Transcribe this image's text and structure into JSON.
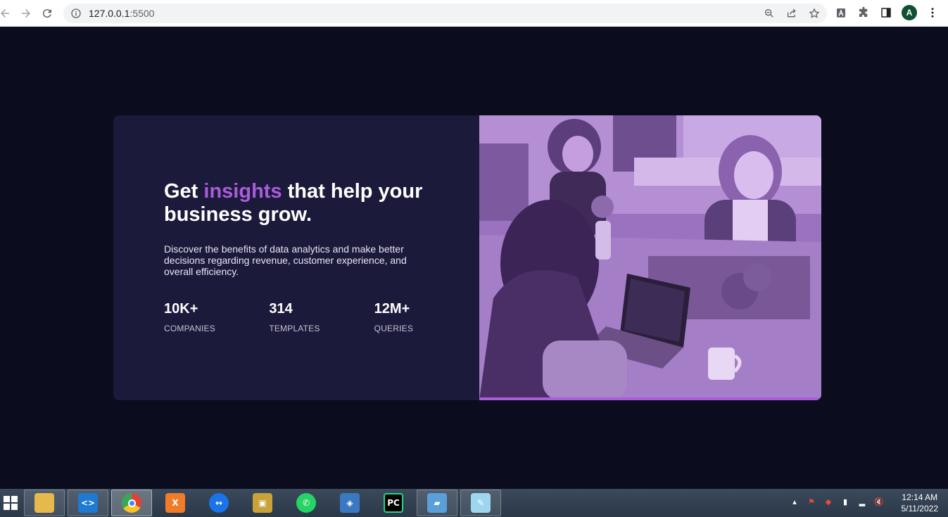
{
  "browser": {
    "url_host": "127.0.0.1",
    "url_port": ":5500",
    "profile_initial": "A",
    "icons": [
      "back-arrow-icon",
      "forward-arrow-icon",
      "reload-icon",
      "info-icon",
      "zoom-icon",
      "share-icon",
      "bookmark-star-icon",
      "extension-a-icon",
      "puzzle-icon",
      "side-panel-icon",
      "avatar",
      "menu-kebab-icon"
    ]
  },
  "hero": {
    "headline_before": "Get ",
    "headline_accent": "insights",
    "headline_after": " that help your business grow.",
    "description": "Discover the benefits of data analytics and make better decisions regarding revenue, customer experience, and overall efficiency.",
    "accent_color": "#aa5cdb",
    "card_color": "#1c1a3a",
    "page_bg": "#0b0c1d",
    "stats": [
      {
        "value": "10K+",
        "label": "COMPANIES"
      },
      {
        "value": "314",
        "label": "TEMPLATES"
      },
      {
        "value": "12M+",
        "label": "QUERIES"
      }
    ]
  },
  "taskbar": {
    "apps": [
      "file-explorer",
      "vs-code",
      "chrome",
      "xampp",
      "teamviewer",
      "app-package",
      "whatsapp",
      "virtualbox",
      "pycharm",
      "photos",
      "notepad"
    ],
    "time": "12:14 AM",
    "date": "5/11/2022"
  }
}
